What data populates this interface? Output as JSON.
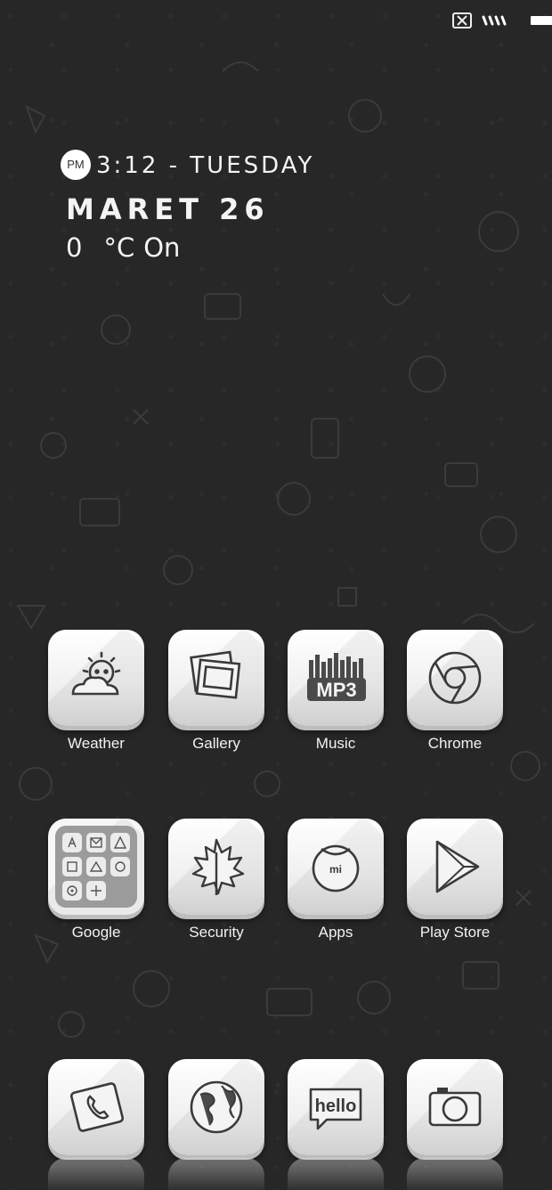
{
  "status_bar": {
    "sim_icon": "no-sim-icon",
    "signal_icon": "signal-icon",
    "battery_icon": "battery-icon"
  },
  "clock_widget": {
    "ampm": "PM",
    "time_day": "3:12 - TUESDAY",
    "date": "MARET 26",
    "temperature": "0",
    "unit": "°C",
    "location": "On"
  },
  "apps": [
    {
      "label": "Weather",
      "icon": "weather-icon"
    },
    {
      "label": "Gallery",
      "icon": "gallery-icon"
    },
    {
      "label": "Music",
      "icon": "music-mp3-icon"
    },
    {
      "label": "Chrome",
      "icon": "chrome-icon"
    },
    {
      "label": "Google",
      "icon": "folder-icon"
    },
    {
      "label": "Security",
      "icon": "leaf-icon"
    },
    {
      "label": "Apps",
      "icon": "mi-apps-icon"
    },
    {
      "label": "Play Store",
      "icon": "play-store-icon"
    }
  ],
  "dock": [
    {
      "icon": "phone-icon"
    },
    {
      "icon": "globe-icon"
    },
    {
      "icon": "messaging-hello-icon",
      "text": "hello"
    },
    {
      "icon": "camera-icon"
    }
  ],
  "music_icon_text": "MP3",
  "apps_icon_text": "mi",
  "colors": {
    "wallpaper": "#272727",
    "tile": "#f0f0f0",
    "text": "#f2f2f2"
  }
}
